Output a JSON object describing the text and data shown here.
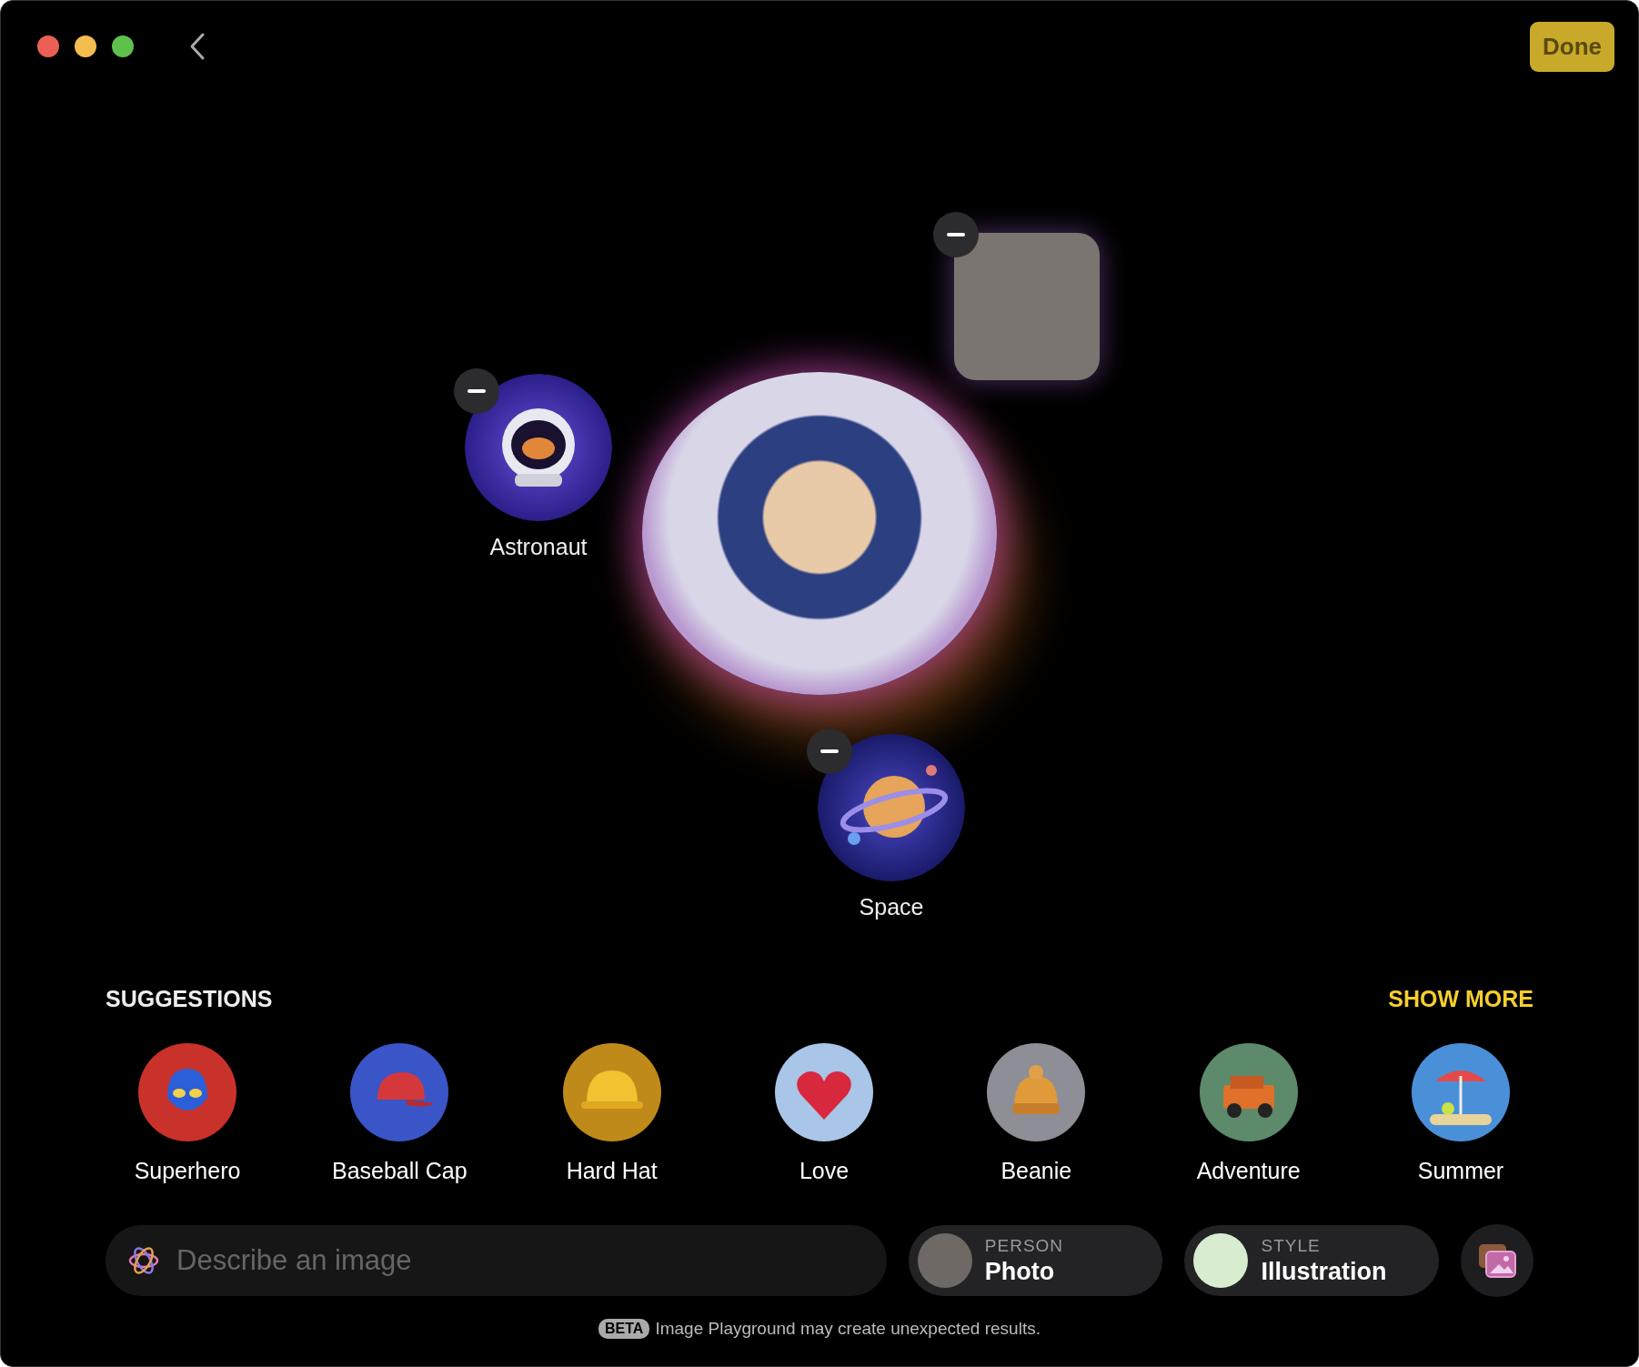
{
  "toolbar": {
    "done_button": "Done"
  },
  "canvas": {
    "elements": [
      {
        "kind": "photo"
      },
      {
        "kind": "concept",
        "label": "Astronaut"
      },
      {
        "kind": "concept",
        "label": "Space"
      }
    ]
  },
  "suggestions": {
    "title": "SUGGESTIONS",
    "show_more": "SHOW MORE",
    "items": [
      {
        "label": "Superhero"
      },
      {
        "label": "Baseball Cap"
      },
      {
        "label": "Hard Hat"
      },
      {
        "label": "Love"
      },
      {
        "label": "Beanie"
      },
      {
        "label": "Adventure"
      },
      {
        "label": "Summer"
      }
    ]
  },
  "prompt": {
    "placeholder": "Describe an image"
  },
  "pickers": [
    {
      "kind": "person",
      "caption": "PERSON",
      "value": "Photo"
    },
    {
      "kind": "style",
      "caption": "STYLE",
      "value": "Illustration"
    }
  ],
  "footer": {
    "badge": "BETA",
    "note": "Image Playground may create unexpected results."
  }
}
